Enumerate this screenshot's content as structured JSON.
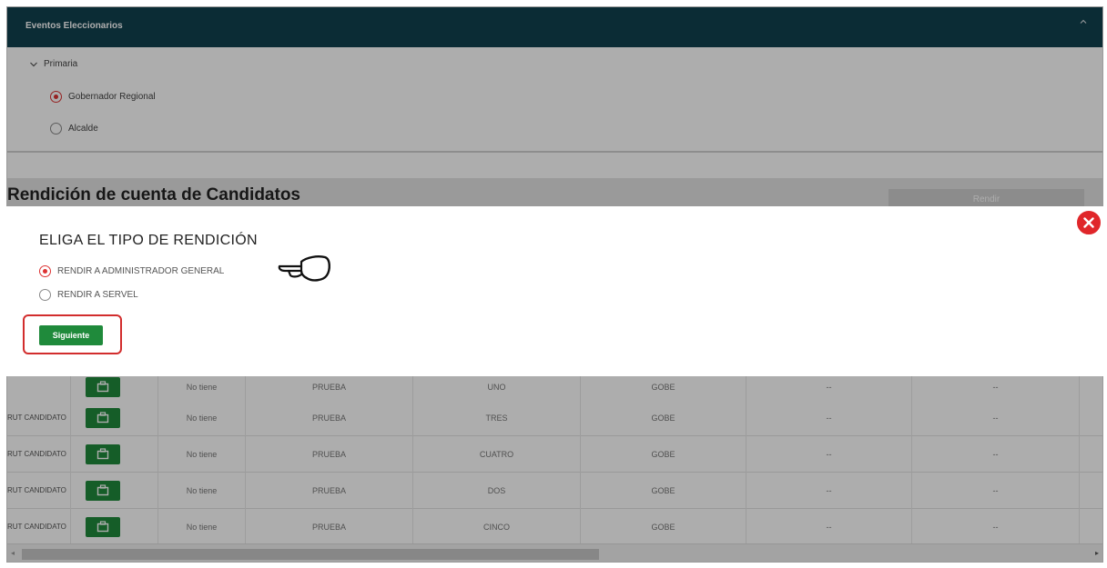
{
  "header": {
    "title": "Eventos Eleccionarios"
  },
  "filters": {
    "group": "Primaria",
    "options": [
      {
        "label": "Gobernador Regional",
        "selected": true
      },
      {
        "label": "Alcalde",
        "selected": false
      }
    ]
  },
  "section": {
    "title": "Rendición de cuenta de Candidatos",
    "action": "Rendir"
  },
  "table": {
    "rows": [
      {
        "rut": "",
        "col3": "No tiene",
        "col4": "PRUEBA",
        "col5": "UNO",
        "col6": "GOBE",
        "col7": "--",
        "col8": "--"
      },
      {
        "rut": "RUT CANDIDATO",
        "col3": "No tiene",
        "col4": "PRUEBA",
        "col5": "TRES",
        "col6": "GOBE",
        "col7": "--",
        "col8": "--"
      },
      {
        "rut": "RUT CANDIDATO",
        "col3": "No tiene",
        "col4": "PRUEBA",
        "col5": "CUATRO",
        "col6": "GOBE",
        "col7": "--",
        "col8": "--"
      },
      {
        "rut": "RUT CANDIDATO",
        "col3": "No tiene",
        "col4": "PRUEBA",
        "col5": "DOS",
        "col6": "GOBE",
        "col7": "--",
        "col8": "--"
      },
      {
        "rut": "RUT CANDIDATO",
        "col3": "No tiene",
        "col4": "PRUEBA",
        "col5": "CINCO",
        "col6": "GOBE",
        "col7": "--",
        "col8": "--"
      }
    ]
  },
  "modal": {
    "title": "ELIGA EL TIPO DE RENDICIÓN",
    "options": [
      {
        "label": "RENDIR A ADMINISTRADOR GENERAL",
        "selected": true
      },
      {
        "label": "RENDIR A SERVEL",
        "selected": false
      }
    ],
    "next_label": "Siguiente"
  },
  "colors": {
    "header": "#11414f",
    "primary_button": "#1f8a3b",
    "highlight": "#d22d2d",
    "close": "#e0262a"
  },
  "icons": {
    "modal_close": "close-icon",
    "row_action": "briefcase-icon",
    "pointer": "pointing-hand-icon",
    "collapse": "chevron-up-icon",
    "expand": "chevron-down-icon"
  }
}
